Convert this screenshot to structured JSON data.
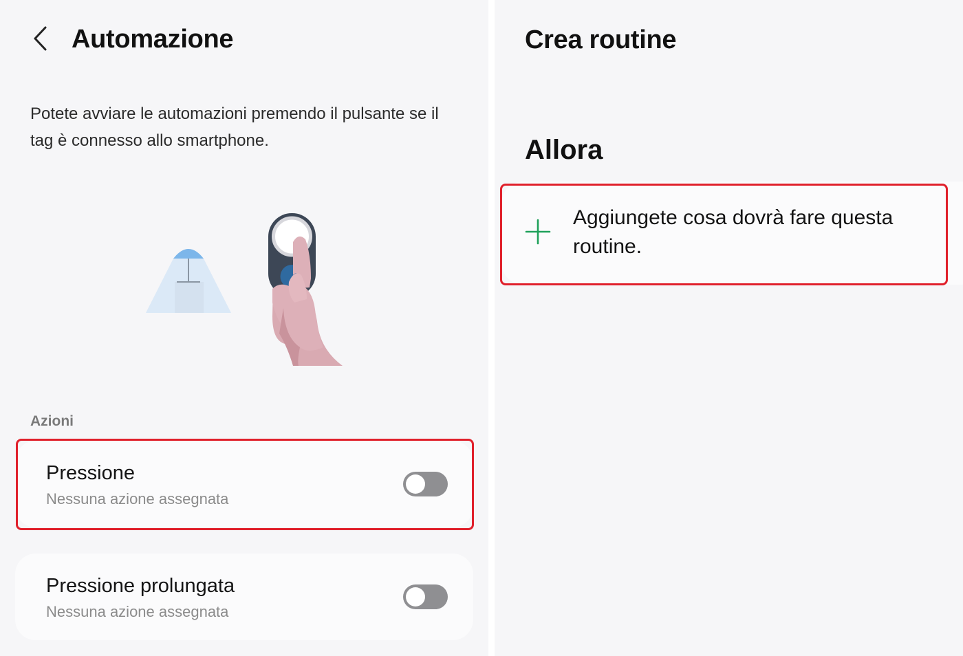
{
  "left_screen": {
    "header": {
      "back_icon": "chevron-left-icon",
      "title": "Automazione"
    },
    "description": "Potete avviare le automazioni premendo il pulsante se il tag è connesso allo smartphone.",
    "illustration": "lamp-and-smart-tag-in-hand",
    "section_label": "Azioni",
    "actions": [
      {
        "title": "Pressione",
        "subtitle": "Nessuna azione assegnata",
        "toggle_on": false,
        "highlighted": true
      },
      {
        "title": "Pressione prolungata",
        "subtitle": "Nessuna azione assegnata",
        "toggle_on": false,
        "highlighted": false
      }
    ]
  },
  "right_screen": {
    "title": "Crea routine",
    "section_heading": "Allora",
    "add_action": {
      "icon": "plus-icon",
      "label": "Aggiungete cosa dovrà fare questa routine.",
      "highlighted": true
    }
  },
  "colors": {
    "background": "#f6f6f8",
    "card": "#fbfbfc",
    "highlight": "#e0202b",
    "plus_icon": "#1fa15a",
    "toggle_off": "#8f8f92"
  }
}
